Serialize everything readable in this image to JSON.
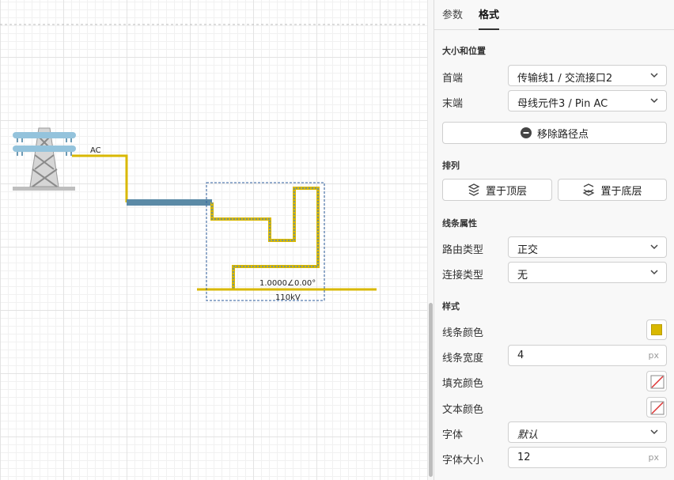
{
  "tabs": [
    {
      "label": "参数",
      "active": false
    },
    {
      "label": "格式",
      "active": true
    }
  ],
  "sections": {
    "size_position": "大小和位置",
    "arrange": "排列",
    "line_props": "线条属性",
    "style": "样式"
  },
  "fields": {
    "head_label": "首端",
    "head_value": "传输线1 / 交流接口2",
    "tail_label": "末端",
    "tail_value": "母线元件3 / Pin AC",
    "remove_waypoints": "移除路径点",
    "bring_to_front": "置于顶层",
    "send_to_back": "置于底层",
    "route_type_label": "路由类型",
    "route_type_value": "正交",
    "connect_type_label": "连接类型",
    "connect_type_value": "无",
    "line_color_label": "线条颜色",
    "line_color_value": "#d9b800",
    "line_width_label": "线条宽度",
    "line_width_value": "4",
    "line_width_unit": "px",
    "fill_color_label": "填充颜色",
    "text_color_label": "文本颜色",
    "font_label": "字体",
    "font_value": "默认",
    "font_size_label": "字体大小",
    "font_size_value": "12",
    "font_size_unit": "px"
  },
  "diagram": {
    "port_label": "AC",
    "bus_value": "1.0000∠0.00°",
    "bus_name": "110kV",
    "colors": {
      "wire": "#d9b800",
      "line_body": "#5b8aa6",
      "selected_dash": "#5a8ab0",
      "selection_box": "#2d5d9c"
    }
  },
  "icons": {
    "chevron": "chevron-down-icon",
    "remove": "minus-circle-icon",
    "front": "bring-to-front-icon",
    "back": "send-to-back-icon",
    "no_color": "no-color-icon",
    "tower": "transmission-tower-icon"
  }
}
